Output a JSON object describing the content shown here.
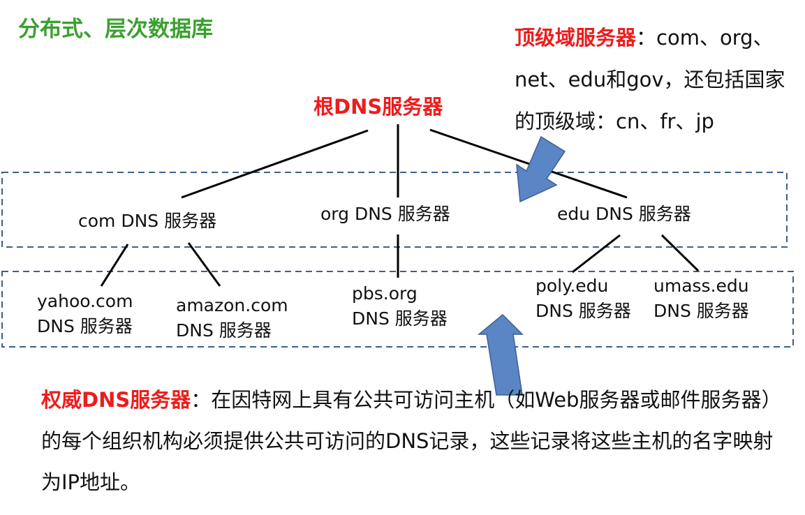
{
  "title": "分布式、层次数据库",
  "tld_note": {
    "label": "顶级域服务器",
    "text": "：com、org、net、edu和gov，还包括国家的顶级域：cn、fr、jp"
  },
  "root": {
    "label": "根DNS服务器"
  },
  "tld_servers": [
    {
      "line1": "com DNS 服务器"
    },
    {
      "line1": "org DNS 服务器"
    },
    {
      "line1": "edu DNS 服务器"
    }
  ],
  "auth_servers": [
    {
      "line1": "yahoo.com",
      "line2": "DNS 服务器"
    },
    {
      "line1": "amazon.com",
      "line2": "DNS 服务器"
    },
    {
      "line1": "pbs.org",
      "line2": "DNS 服务器"
    },
    {
      "line1": "poly.edu",
      "line2": "DNS 服务器"
    },
    {
      "line1": "umass.edu",
      "line2": "DNS 服务器"
    }
  ],
  "auth_note": {
    "label": "权威DNS服务器",
    "text": "：在因特网上具有公共可访问主机（如Web服务器或邮件服务器）的每个组织机构必须提供公共可访问的DNS记录，这些记录将这些主机的名字映射为IP地址。"
  },
  "colors": {
    "title_green": "#3aa02f",
    "highlight_red": "#ee1c1c",
    "arrow_blue": "#5b86c5",
    "dashed_box": "#3f5f86"
  }
}
